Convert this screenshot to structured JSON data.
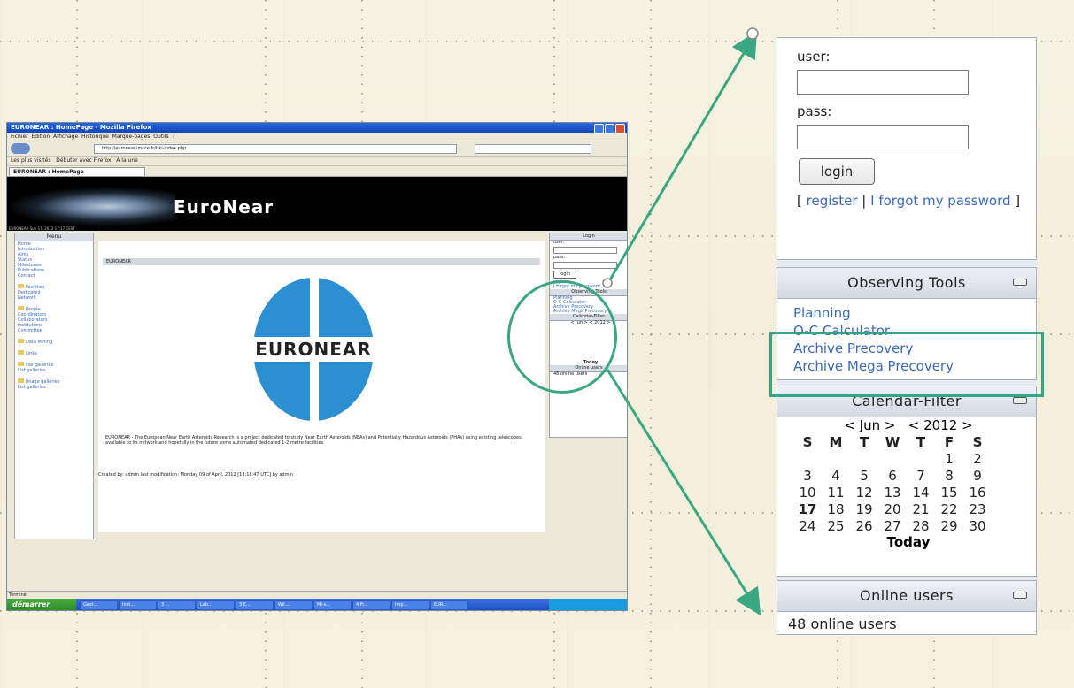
{
  "window": {
    "title": "EURONEAR : HomePage - Mozilla Firefox",
    "menu": [
      "Fichier",
      "Édition",
      "Affichage",
      "Historique",
      "Marque-pages",
      "Outils",
      "?"
    ],
    "url": "http://euronear.imcce.fr/tiki-index.php",
    "bookmarks": [
      "Les plus visités",
      "Débuter avec Firefox",
      "À la une"
    ],
    "tab": "EURONEAR : HomePage",
    "status": "Terminé"
  },
  "site": {
    "banner": "EuroNear",
    "date_line": "EURONEAR Sun 17, 2012 17:17 CEST",
    "menu_title": "Menu",
    "menu_items": [
      "Home",
      "Introduction",
      "Aims",
      "Status",
      "Milestones",
      "Publications",
      "Contact"
    ],
    "menu_groups": [
      "Facilities",
      "Dedicated",
      "Network",
      "People",
      "Coordinators",
      "Collaborators",
      "Institutions",
      "Committee",
      "Data Mining",
      "Links",
      "File galleries",
      "List galleries",
      "Image galleries",
      "List galleries"
    ],
    "breadcrumb": "EURONEAR",
    "logo_text": "EURONEAR",
    "description": "EURONEAR - The European Near Earth Asteroids Research is a project dedicated to study Near Earth Asteroids (NEAs) and Potentially Hazardous Asteroids (PHAs) using existing telescopes available to its network and hopefully in the future some automated dedicated 1-2 metre facilities.",
    "created": "Created by: admin last modification: Monday 09 of April, 2012 [13:18:47 UTC] by admin",
    "mini_login": "Login",
    "mini_obs": "Observing Tools",
    "mini_cal": "Calendar-Filter",
    "mini_online": "Online users"
  },
  "taskbar": {
    "start": "démarrer",
    "items": [
      "Gest...",
      "Inst...",
      "3 ...",
      "Lab...",
      "3 E...",
      "Wil...",
      "Mi-s...",
      "4 Fi...",
      "Imp...",
      "EUR..."
    ]
  },
  "login": {
    "user_label": "user:",
    "pass_label": "pass:",
    "button": "login",
    "bracket_open": "[",
    "register": "register",
    "sep": "|",
    "forgot": "I forgot my password",
    "bracket_close": "]"
  },
  "observing_tools": {
    "title": "Observing Tools",
    "items": [
      "Planning",
      "O-C Calculator",
      "Archive Precovery",
      "Archive Mega Precovery"
    ]
  },
  "calendar": {
    "title": "Calendar-Filter",
    "nav_month": "< Jun >",
    "nav_year": "< 2012 >",
    "weekdays": [
      "S",
      "M",
      "T",
      "W",
      "T",
      "F",
      "S"
    ],
    "weeks": [
      [
        "",
        "",
        "",
        "",
        "",
        "1",
        "2"
      ],
      [
        "3",
        "4",
        "5",
        "6",
        "7",
        "8",
        "9"
      ],
      [
        "10",
        "11",
        "12",
        "13",
        "14",
        "15",
        "16"
      ],
      [
        "17",
        "18",
        "19",
        "20",
        "21",
        "22",
        "23"
      ],
      [
        "24",
        "25",
        "26",
        "27",
        "28",
        "29",
        "30"
      ]
    ],
    "today_day": "17",
    "today_label": "Today"
  },
  "online_users": {
    "title": "Online users",
    "text": "48 online users"
  },
  "colors": {
    "accent_green": "#2fa885",
    "link_blue": "#3a6ab8",
    "logo_blue": "#2b8fd1"
  }
}
